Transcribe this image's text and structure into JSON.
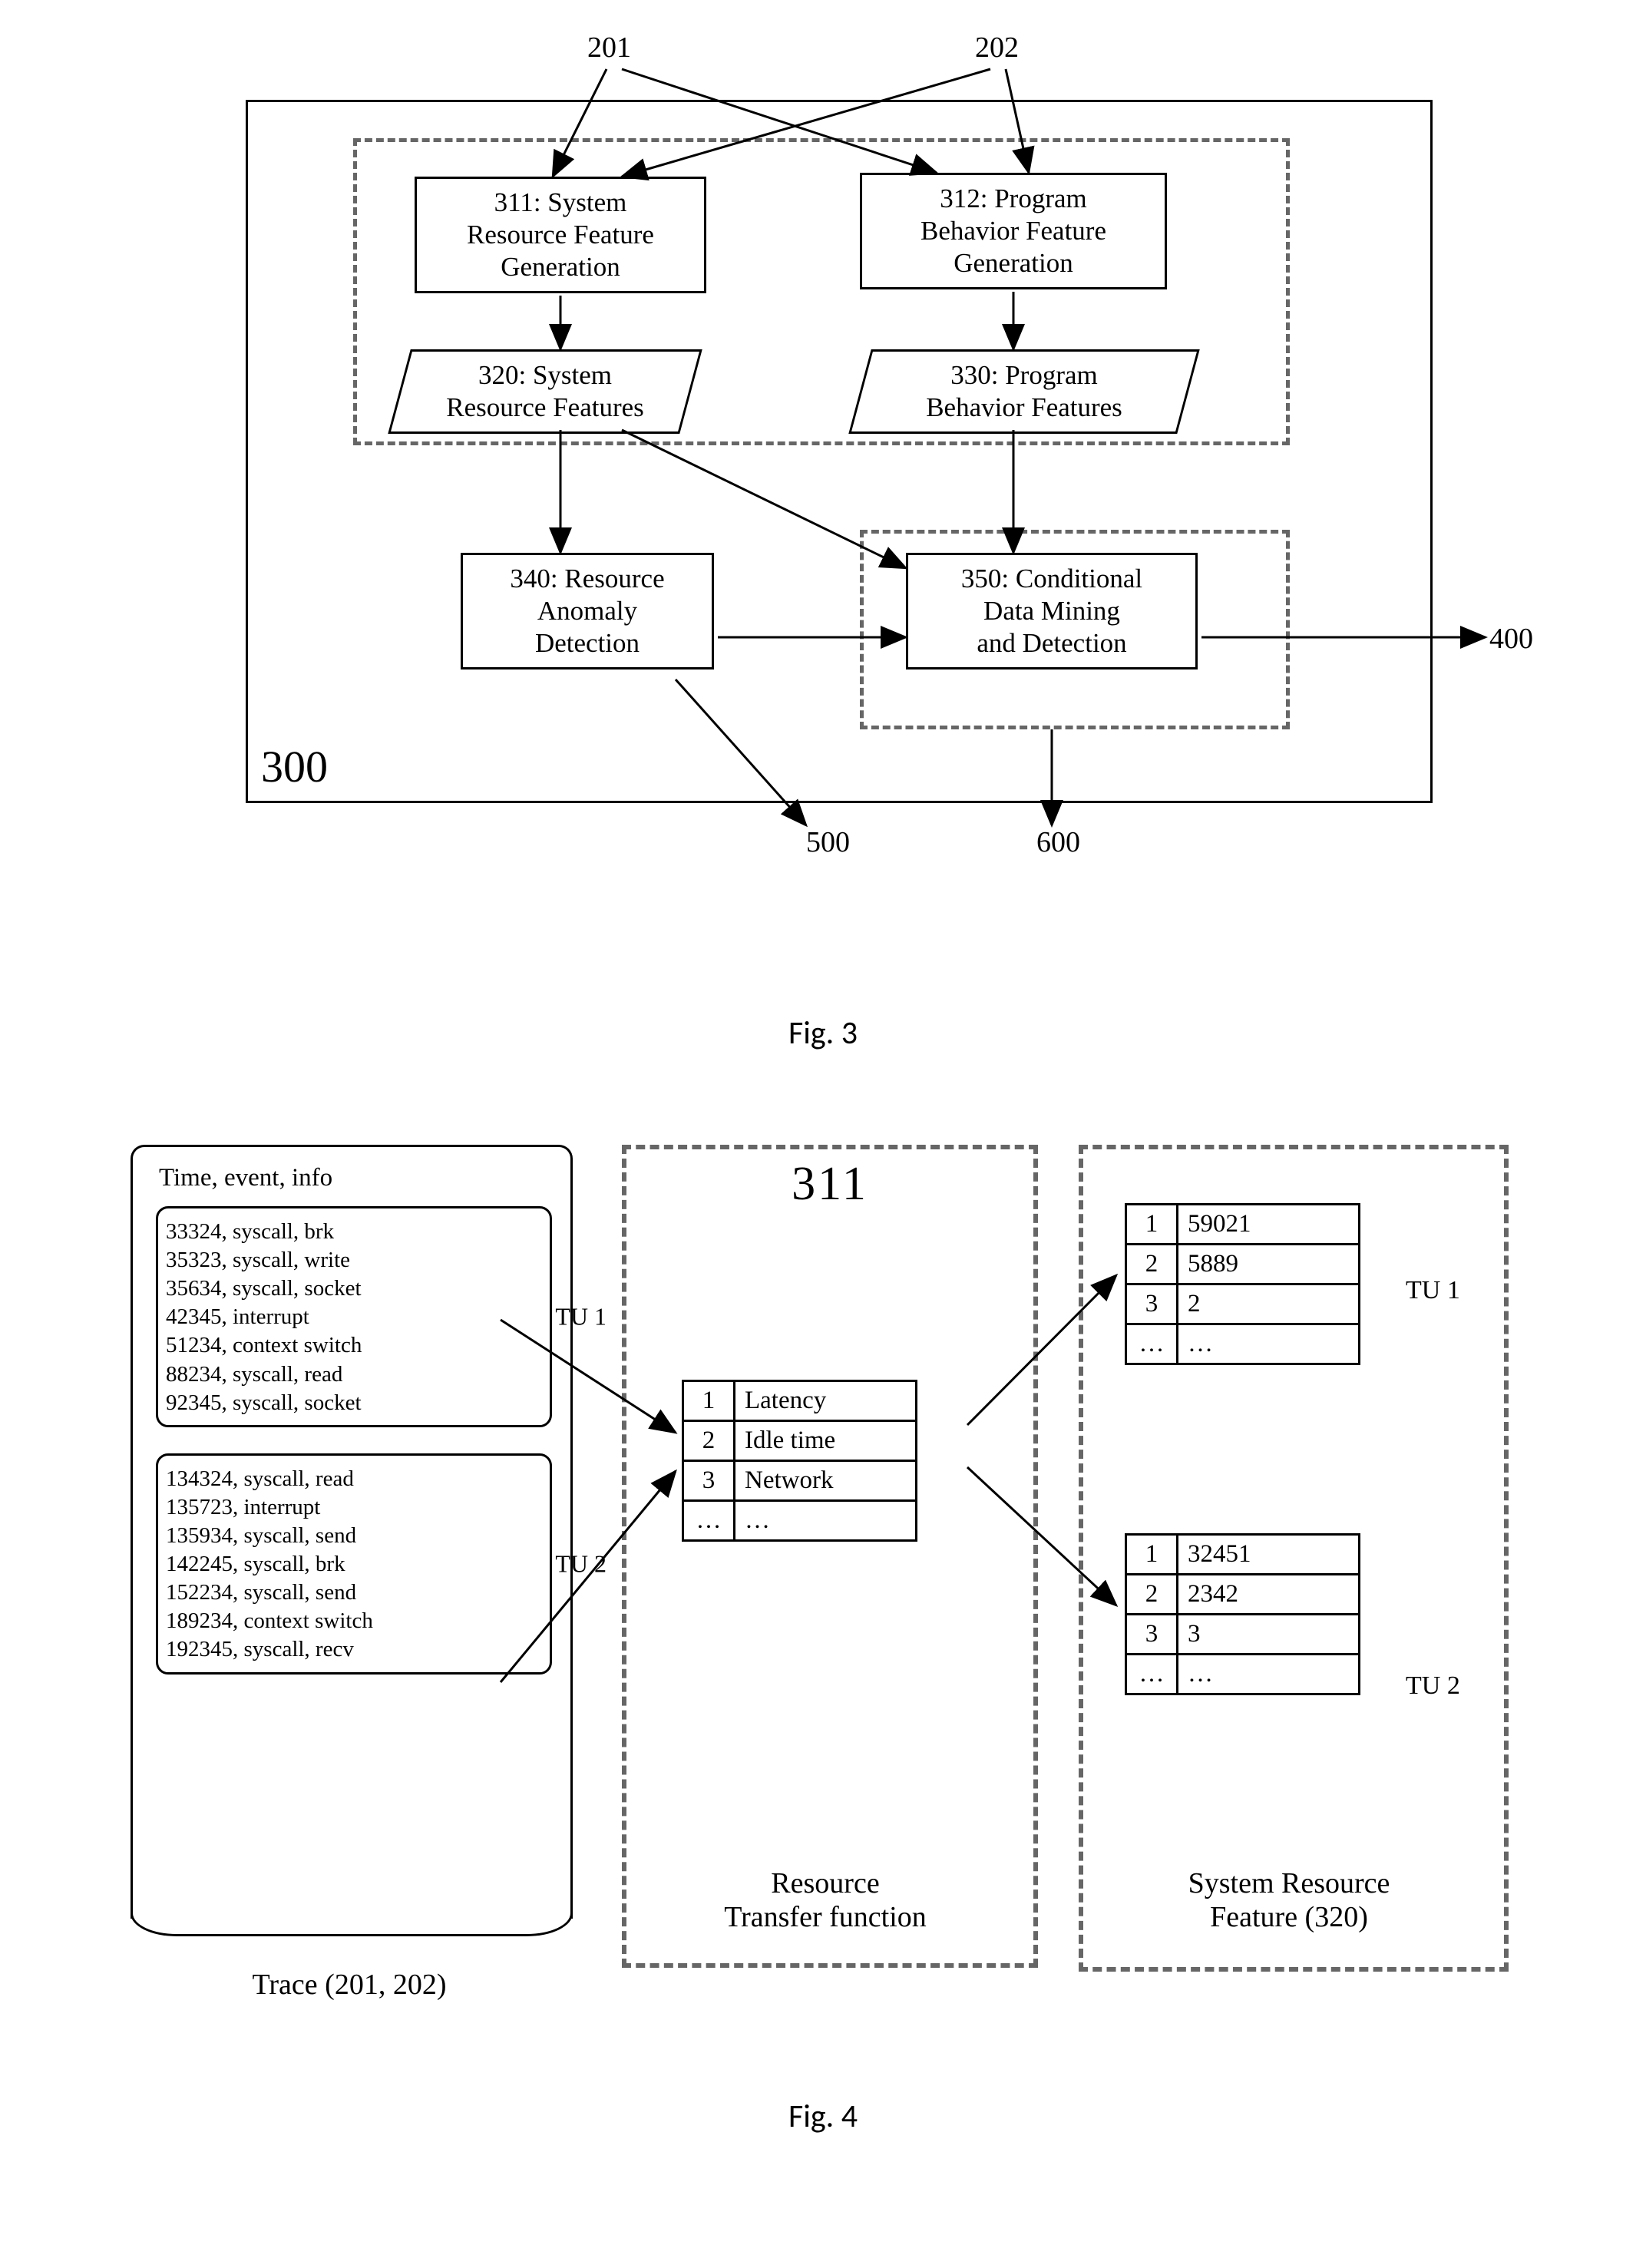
{
  "fig3": {
    "top_inputs": {
      "left": "201",
      "right": "202"
    },
    "nodes": {
      "n311": {
        "id": "311",
        "title": "System\nResource Feature\nGeneration"
      },
      "n312": {
        "id": "312",
        "title": "Program\nBehavior Feature\nGeneration"
      },
      "n320": {
        "id": "320",
        "title": "System\nResource Features"
      },
      "n330": {
        "id": "330",
        "title": "Program\nBehavior Features"
      },
      "n340": {
        "id": "340",
        "title": "Resource\nAnomaly\nDetection"
      },
      "n350": {
        "id": "350",
        "title": "Conditional\nData Mining\nand Detection"
      }
    },
    "outer_label": "300",
    "out_labels": {
      "from340": "500",
      "from350": "600",
      "out350_right": "400"
    },
    "caption": "Fig. 3"
  },
  "fig4": {
    "trace": {
      "header": "Time, event, info",
      "tu1": {
        "label": "TU 1",
        "lines": [
          "33324, syscall, brk",
          "35323, syscall, write",
          "35634, syscall, socket",
          "42345, interrupt",
          "51234, context switch",
          "88234, syscall, read",
          "92345, syscall, socket"
        ]
      },
      "tu2": {
        "label": "TU 2",
        "lines": [
          "134324, syscall, read",
          "135723, interrupt",
          "135934, syscall, send",
          "142245, syscall, brk",
          "152234, syscall, send",
          "189234, context switch",
          "192345, syscall, recv"
        ]
      },
      "caption": "Trace (201, 202)"
    },
    "mid": {
      "title": "311",
      "rows": [
        {
          "k": "1",
          "v": "Latency"
        },
        {
          "k": "2",
          "v": "Idle time"
        },
        {
          "k": "3",
          "v": "Network"
        },
        {
          "k": "…",
          "v": "…"
        }
      ],
      "caption": "Resource\nTransfer function"
    },
    "right": {
      "tu1": {
        "label": "TU 1",
        "rows": [
          {
            "k": "1",
            "v": "59021"
          },
          {
            "k": "2",
            "v": "5889"
          },
          {
            "k": "3",
            "v": "2"
          },
          {
            "k": "…",
            "v": "…"
          }
        ]
      },
      "tu2": {
        "label": "TU 2",
        "rows": [
          {
            "k": "1",
            "v": "32451"
          },
          {
            "k": "2",
            "v": "2342"
          },
          {
            "k": "3",
            "v": "3"
          },
          {
            "k": "…",
            "v": "…"
          }
        ]
      },
      "caption": "System Resource\nFeature (320)"
    },
    "caption": "Fig. 4"
  }
}
